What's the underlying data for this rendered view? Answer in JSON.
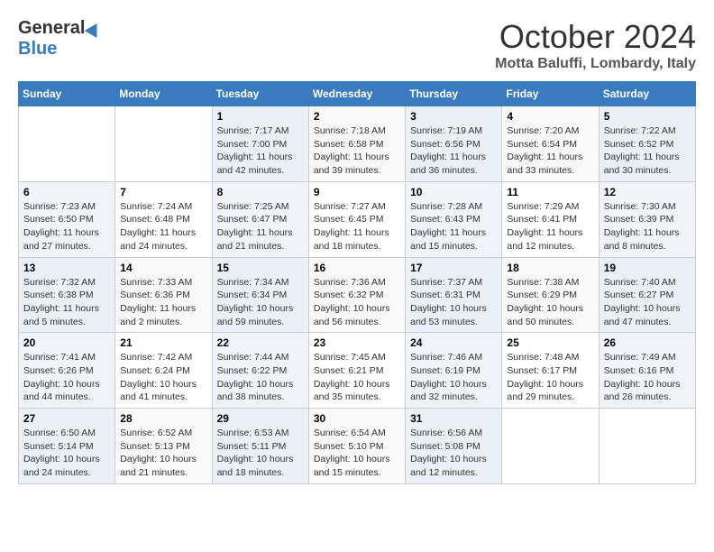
{
  "header": {
    "logo_general": "General",
    "logo_blue": "Blue",
    "month": "October 2024",
    "location": "Motta Baluffi, Lombardy, Italy"
  },
  "days_of_week": [
    "Sunday",
    "Monday",
    "Tuesday",
    "Wednesday",
    "Thursday",
    "Friday",
    "Saturday"
  ],
  "weeks": [
    [
      {
        "num": "",
        "detail": ""
      },
      {
        "num": "",
        "detail": ""
      },
      {
        "num": "1",
        "detail": "Sunrise: 7:17 AM\nSunset: 7:00 PM\nDaylight: 11 hours and 42 minutes."
      },
      {
        "num": "2",
        "detail": "Sunrise: 7:18 AM\nSunset: 6:58 PM\nDaylight: 11 hours and 39 minutes."
      },
      {
        "num": "3",
        "detail": "Sunrise: 7:19 AM\nSunset: 6:56 PM\nDaylight: 11 hours and 36 minutes."
      },
      {
        "num": "4",
        "detail": "Sunrise: 7:20 AM\nSunset: 6:54 PM\nDaylight: 11 hours and 33 minutes."
      },
      {
        "num": "5",
        "detail": "Sunrise: 7:22 AM\nSunset: 6:52 PM\nDaylight: 11 hours and 30 minutes."
      }
    ],
    [
      {
        "num": "6",
        "detail": "Sunrise: 7:23 AM\nSunset: 6:50 PM\nDaylight: 11 hours and 27 minutes."
      },
      {
        "num": "7",
        "detail": "Sunrise: 7:24 AM\nSunset: 6:48 PM\nDaylight: 11 hours and 24 minutes."
      },
      {
        "num": "8",
        "detail": "Sunrise: 7:25 AM\nSunset: 6:47 PM\nDaylight: 11 hours and 21 minutes."
      },
      {
        "num": "9",
        "detail": "Sunrise: 7:27 AM\nSunset: 6:45 PM\nDaylight: 11 hours and 18 minutes."
      },
      {
        "num": "10",
        "detail": "Sunrise: 7:28 AM\nSunset: 6:43 PM\nDaylight: 11 hours and 15 minutes."
      },
      {
        "num": "11",
        "detail": "Sunrise: 7:29 AM\nSunset: 6:41 PM\nDaylight: 11 hours and 12 minutes."
      },
      {
        "num": "12",
        "detail": "Sunrise: 7:30 AM\nSunset: 6:39 PM\nDaylight: 11 hours and 8 minutes."
      }
    ],
    [
      {
        "num": "13",
        "detail": "Sunrise: 7:32 AM\nSunset: 6:38 PM\nDaylight: 11 hours and 5 minutes."
      },
      {
        "num": "14",
        "detail": "Sunrise: 7:33 AM\nSunset: 6:36 PM\nDaylight: 11 hours and 2 minutes."
      },
      {
        "num": "15",
        "detail": "Sunrise: 7:34 AM\nSunset: 6:34 PM\nDaylight: 10 hours and 59 minutes."
      },
      {
        "num": "16",
        "detail": "Sunrise: 7:36 AM\nSunset: 6:32 PM\nDaylight: 10 hours and 56 minutes."
      },
      {
        "num": "17",
        "detail": "Sunrise: 7:37 AM\nSunset: 6:31 PM\nDaylight: 10 hours and 53 minutes."
      },
      {
        "num": "18",
        "detail": "Sunrise: 7:38 AM\nSunset: 6:29 PM\nDaylight: 10 hours and 50 minutes."
      },
      {
        "num": "19",
        "detail": "Sunrise: 7:40 AM\nSunset: 6:27 PM\nDaylight: 10 hours and 47 minutes."
      }
    ],
    [
      {
        "num": "20",
        "detail": "Sunrise: 7:41 AM\nSunset: 6:26 PM\nDaylight: 10 hours and 44 minutes."
      },
      {
        "num": "21",
        "detail": "Sunrise: 7:42 AM\nSunset: 6:24 PM\nDaylight: 10 hours and 41 minutes."
      },
      {
        "num": "22",
        "detail": "Sunrise: 7:44 AM\nSunset: 6:22 PM\nDaylight: 10 hours and 38 minutes."
      },
      {
        "num": "23",
        "detail": "Sunrise: 7:45 AM\nSunset: 6:21 PM\nDaylight: 10 hours and 35 minutes."
      },
      {
        "num": "24",
        "detail": "Sunrise: 7:46 AM\nSunset: 6:19 PM\nDaylight: 10 hours and 32 minutes."
      },
      {
        "num": "25",
        "detail": "Sunrise: 7:48 AM\nSunset: 6:17 PM\nDaylight: 10 hours and 29 minutes."
      },
      {
        "num": "26",
        "detail": "Sunrise: 7:49 AM\nSunset: 6:16 PM\nDaylight: 10 hours and 26 minutes."
      }
    ],
    [
      {
        "num": "27",
        "detail": "Sunrise: 6:50 AM\nSunset: 5:14 PM\nDaylight: 10 hours and 24 minutes."
      },
      {
        "num": "28",
        "detail": "Sunrise: 6:52 AM\nSunset: 5:13 PM\nDaylight: 10 hours and 21 minutes."
      },
      {
        "num": "29",
        "detail": "Sunrise: 6:53 AM\nSunset: 5:11 PM\nDaylight: 10 hours and 18 minutes."
      },
      {
        "num": "30",
        "detail": "Sunrise: 6:54 AM\nSunset: 5:10 PM\nDaylight: 10 hours and 15 minutes."
      },
      {
        "num": "31",
        "detail": "Sunrise: 6:56 AM\nSunset: 5:08 PM\nDaylight: 10 hours and 12 minutes."
      },
      {
        "num": "",
        "detail": ""
      },
      {
        "num": "",
        "detail": ""
      }
    ]
  ]
}
